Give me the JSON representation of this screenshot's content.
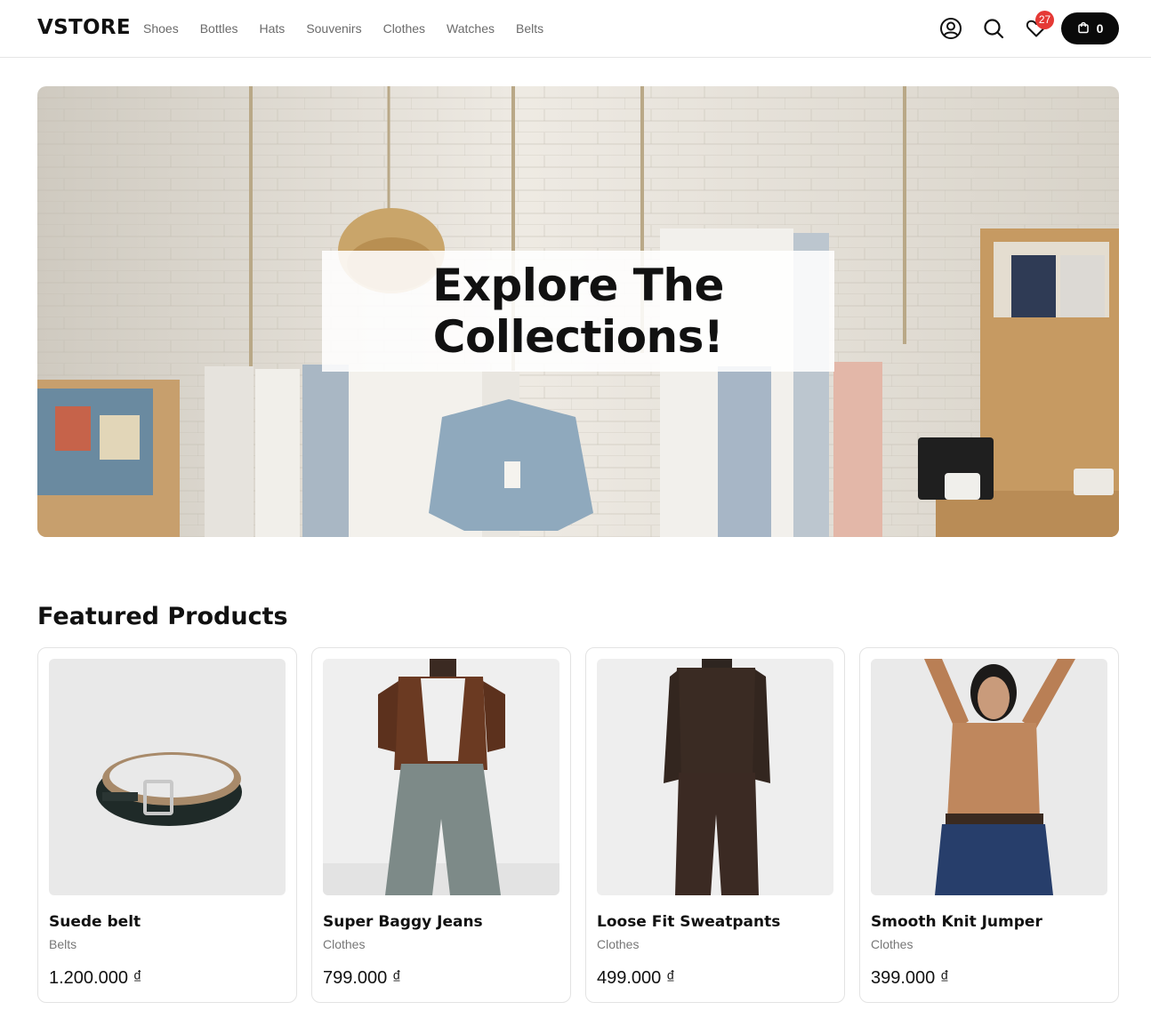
{
  "header": {
    "logo": "VSTORE",
    "nav": [
      "Shoes",
      "Bottles",
      "Hats",
      "Souvenirs",
      "Clothes",
      "Watches",
      "Belts"
    ],
    "icons": [
      "user-icon",
      "search-icon",
      "heart-icon",
      "cart-icon"
    ],
    "wishlist_count": "27",
    "cart_count": "0"
  },
  "hero": {
    "title_line1": "Explore The",
    "title_line2": "Collections!"
  },
  "featured": {
    "title": "Featured Products",
    "products": [
      {
        "name": "Suede belt",
        "category": "Belts",
        "price": "1.200.000 ₫"
      },
      {
        "name": "Super Baggy Jeans",
        "category": "Clothes",
        "price": "799.000 ₫"
      },
      {
        "name": "Loose Fit Sweatpants",
        "category": "Clothes",
        "price": "499.000 ₫"
      },
      {
        "name": "Smooth Knit Jumper",
        "category": "Clothes",
        "price": "399.000 ₫"
      }
    ]
  },
  "colors": {
    "accent": "#0a0a0a",
    "badge": "#e53935",
    "muted_text": "#6b6b6b"
  }
}
